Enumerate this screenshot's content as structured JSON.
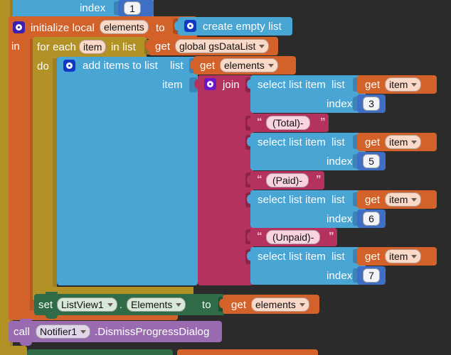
{
  "app": {
    "name": "MIT App Inventor Blocks Editor",
    "canvas_background": "#2b2b2b"
  },
  "colors": {
    "control_olive": "#b29226",
    "variables_orange": "#d3622a",
    "lists_blue": "#49a6d4",
    "text_magenta": "#b3325f",
    "math_blue": "#3e6fc4",
    "component_set_green": "#2e6b46",
    "component_call_purple": "#9a6bb0",
    "mutator_gear_indigo": "#3a1fb0"
  },
  "blocks": {
    "top_partial": {
      "type": "select-list-item-fragment",
      "index_label": "index",
      "index_value": "1"
    },
    "initialize_local": {
      "keyword": "initialize local",
      "variable": "elements",
      "to_label": "to",
      "in_label": "in",
      "value_block": {
        "label": "create empty list"
      }
    },
    "for_each": {
      "prefix": "for each",
      "variable": "item",
      "in_list_label": "in list",
      "do_label": "do",
      "list_value": {
        "get_label": "get",
        "variable": "global gsDataList"
      }
    },
    "add_items_to_list": {
      "label": "add items to list",
      "list_socket_label": "list",
      "item_socket_label": "item",
      "list_value": {
        "get_label": "get",
        "variable": "elements"
      }
    },
    "join": {
      "label": "join",
      "arguments": [
        {
          "kind": "select-list-item",
          "label": "select list item",
          "list_label": "list",
          "index_label": "index",
          "list_value": {
            "get_label": "get",
            "variable": "item"
          },
          "index_value": "3"
        },
        {
          "kind": "text",
          "value": "(Total)-"
        },
        {
          "kind": "select-list-item",
          "label": "select list item",
          "list_label": "list",
          "index_label": "index",
          "list_value": {
            "get_label": "get",
            "variable": "item"
          },
          "index_value": "5"
        },
        {
          "kind": "text",
          "value": "(Paid)-"
        },
        {
          "kind": "select-list-item",
          "label": "select list item",
          "list_label": "list",
          "index_label": "index",
          "list_value": {
            "get_label": "get",
            "variable": "item"
          },
          "index_value": "6"
        },
        {
          "kind": "text",
          "value": "(Unpaid)-"
        },
        {
          "kind": "select-list-item",
          "label": "select list item",
          "list_label": "list",
          "index_label": "index",
          "list_value": {
            "get_label": "get",
            "variable": "item"
          },
          "index_value": "7"
        }
      ]
    },
    "set_property": {
      "set_label": "set",
      "component": "ListView1",
      "dot": ".",
      "property": "Elements",
      "to_label": "to",
      "value": {
        "get_label": "get",
        "variable": "elements"
      }
    },
    "call_method": {
      "call_label": "call",
      "component": "Notifier1",
      "method": ".DismissProgressDialog"
    }
  }
}
